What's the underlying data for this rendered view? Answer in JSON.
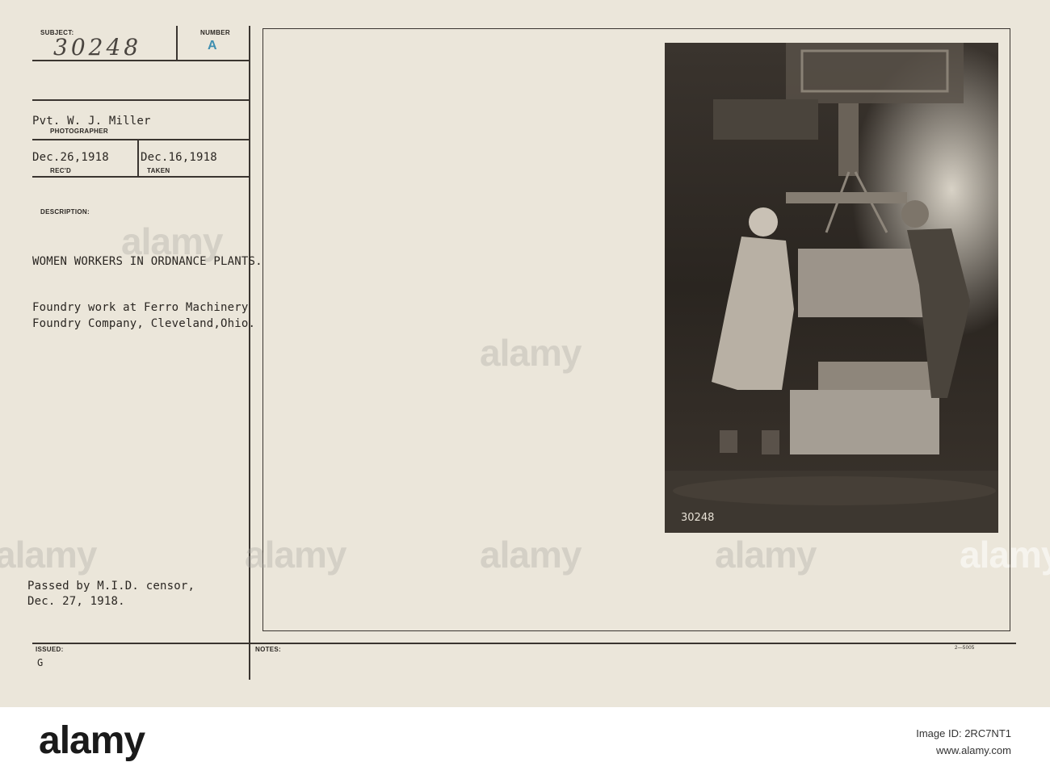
{
  "card": {
    "subject_label": "SUBJECT:",
    "subject_number": "30248",
    "number_label": "NUMBER",
    "number_value": "A",
    "photographer": "Pvt. W. J. Miller",
    "photographer_label": "PHOTOGRAPHER",
    "received": "Dec.26,1918",
    "received_label": "REC'D",
    "taken": "Dec.16,1918",
    "taken_label": "TAKEN",
    "description_label": "DESCRIPTION:",
    "description_title": "WOMEN WORKERS IN ORDNANCE PLANTS.",
    "description_line1": "Foundry work at Ferro Machinery",
    "description_line2": "Foundry Company, Cleveland,Ohio.",
    "censor_line1": "Passed by M.I.D. censor,",
    "censor_line2": "Dec. 27, 1918.",
    "issued_label": "ISSUED:",
    "issued_value": "G",
    "notes_label": "NOTES:",
    "form_number": "2—5005",
    "negative_number": "30248"
  },
  "watermark": "alamy",
  "footer": {
    "logo": "alamy",
    "image_id": "Image ID: 2RC7NT1",
    "site": "www.alamy.com"
  }
}
